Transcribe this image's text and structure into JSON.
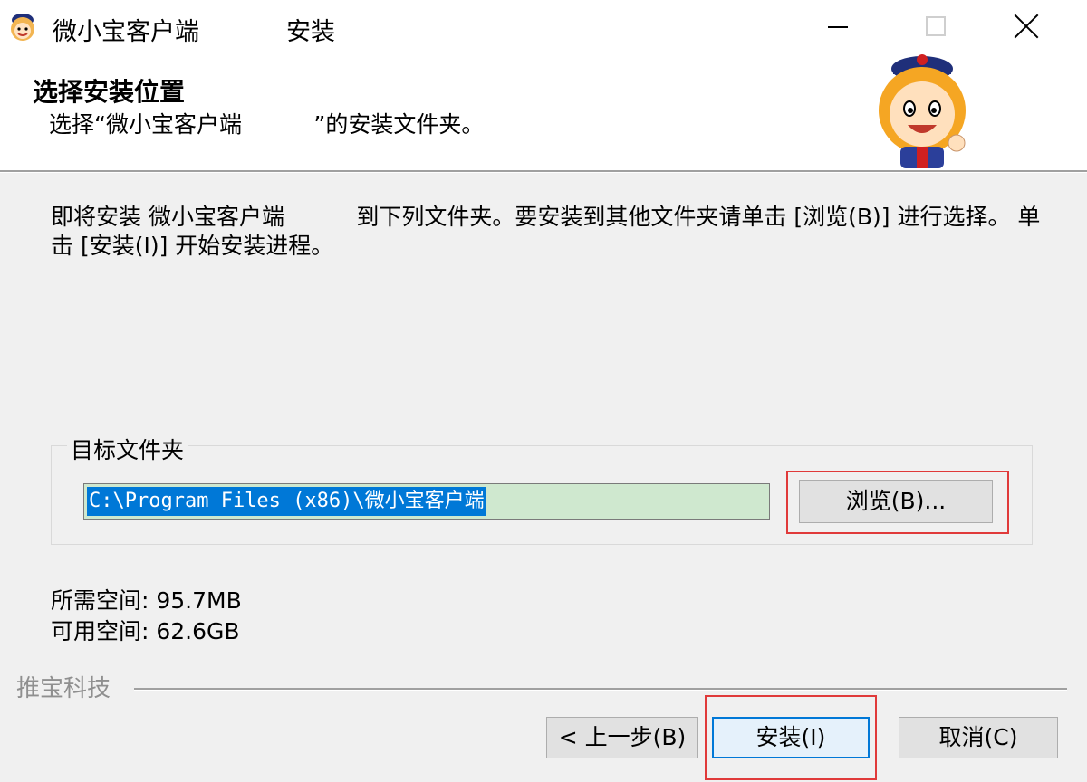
{
  "window": {
    "title_left": "微小宝客户端",
    "title_right": "安装"
  },
  "header": {
    "title": "选择安装位置",
    "subtitle": "选择“微小宝客户端          ”的安装文件夹。"
  },
  "description": "即将安装 微小宝客户端          到下列文件夹。要安装到其他文件夹请单击 [浏览(B)] 进行选择。 单击 [安装(I)] 开始安装进程。",
  "destination": {
    "group_label": "目标文件夹",
    "path": "C:\\Program Files (x86)\\微小宝客户端",
    "browse_label": "浏览(B)..."
  },
  "space": {
    "required": "所需空间: 95.7MB",
    "available": "可用空间: 62.6GB"
  },
  "footer": {
    "brand": "推宝科技",
    "back_label": "< 上一步(B)",
    "install_label": "安装(I)",
    "cancel_label": "取消(C)"
  },
  "colors": {
    "accent": "#0078d7",
    "highlight": "#e03a3a",
    "background": "#f0f0f0"
  },
  "icons": [
    "app-mascot-icon",
    "minimize-icon",
    "maximize-icon",
    "close-icon",
    "mascot-logo"
  ]
}
